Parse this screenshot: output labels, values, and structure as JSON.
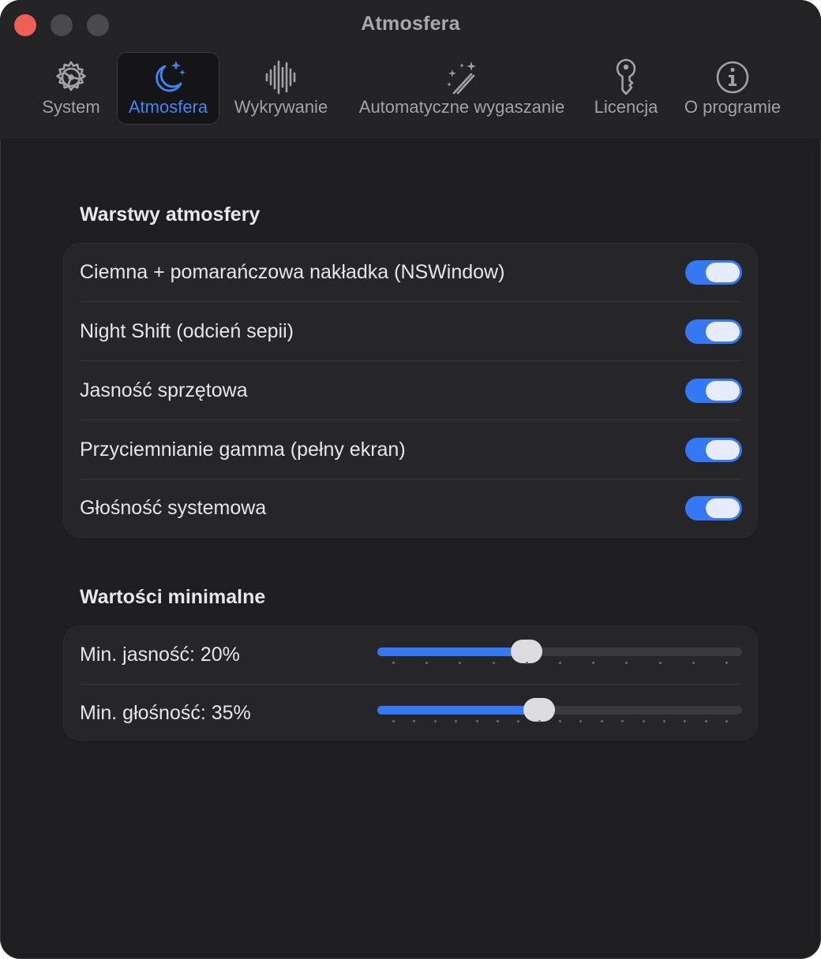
{
  "window": {
    "title": "Atmosfera"
  },
  "tabs": [
    {
      "label": "System",
      "icon": "gear-icon",
      "selected": false
    },
    {
      "label": "Atmosfera",
      "icon": "moon-stars-icon",
      "selected": true
    },
    {
      "label": "Wykrywanie",
      "icon": "waveform-icon",
      "selected": false
    },
    {
      "label": "Automatyczne wygaszanie",
      "icon": "magic-wand-icon",
      "selected": false
    },
    {
      "label": "Licencja",
      "icon": "key-icon",
      "selected": false
    },
    {
      "label": "O programie",
      "icon": "info-icon",
      "selected": false
    }
  ],
  "layers": {
    "title": "Warstwy atmosfery",
    "items": [
      {
        "label": "Ciemna + pomarańczowa nakładka (NSWindow)",
        "on": true
      },
      {
        "label": "Night Shift (odcień sepii)",
        "on": true
      },
      {
        "label": "Jasność sprzętowa",
        "on": true
      },
      {
        "label": "Przyciemnianie gamma (pełny ekran)",
        "on": true
      },
      {
        "label": "Głośność systemowa",
        "on": true
      }
    ]
  },
  "minimums": {
    "title": "Wartości minimalne",
    "items": [
      {
        "label": "Min. jasność: 20%",
        "value": 20,
        "min": 0,
        "max": 50,
        "ticks": 11
      },
      {
        "label": "Min. głośność: 35%",
        "value": 35,
        "min": 0,
        "max": 80,
        "ticks": 17
      }
    ]
  },
  "colors": {
    "accent": "#3478f6",
    "close": "#ed5f57",
    "background": "#1e1e20"
  }
}
